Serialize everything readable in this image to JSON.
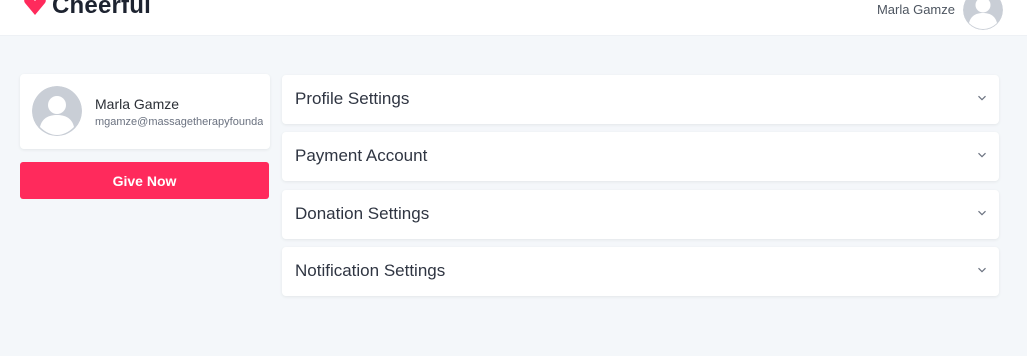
{
  "header": {
    "brand_name": "Cheerful",
    "brand_color": "#ff2a5c",
    "user_name": "Marla Gamze",
    "avatar_icon": "user-avatar-icon"
  },
  "profile": {
    "name": "Marla Gamze",
    "email": "mgamze@massagetherapyfoundation.org",
    "avatar_icon": "user-avatar-icon"
  },
  "actions": {
    "give_now_label": "Give Now",
    "give_now_color": "#ff2a5c"
  },
  "settings_panels": [
    {
      "title": "Profile Settings",
      "icon": "chevron-down-icon"
    },
    {
      "title": "Payment Account",
      "icon": "chevron-down-icon"
    },
    {
      "title": "Donation Settings",
      "icon": "chevron-down-icon"
    },
    {
      "title": "Notification Settings",
      "icon": "chevron-down-icon"
    }
  ]
}
